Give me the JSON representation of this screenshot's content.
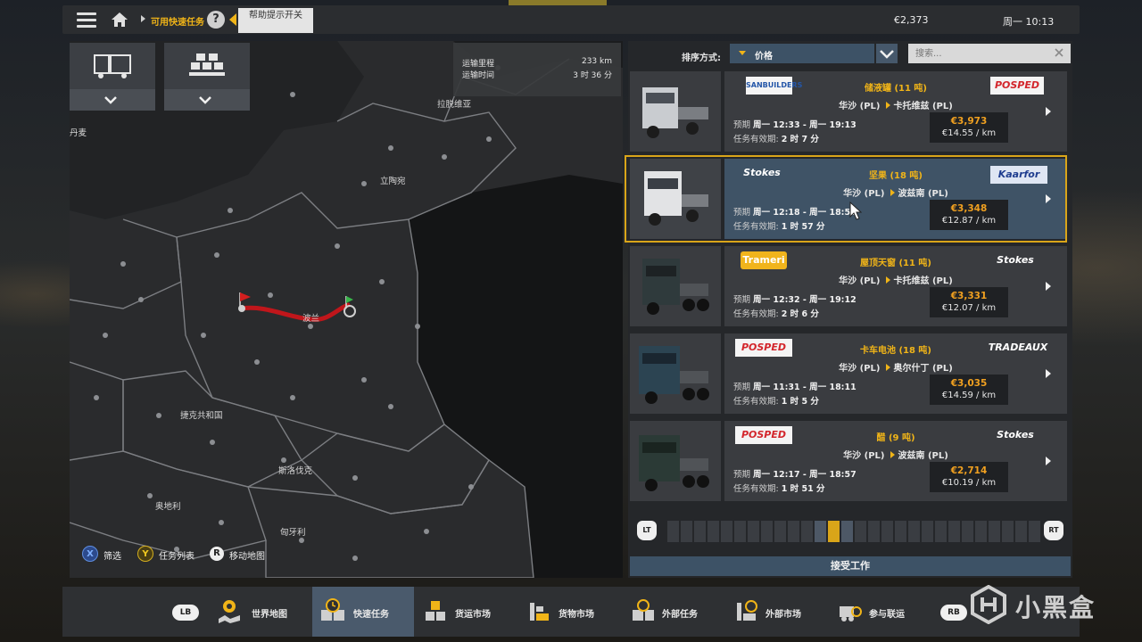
{
  "topbar": {
    "breadcrumb": "可用快速任务",
    "help_tooltip": "帮助提示开关",
    "money": "€2,373",
    "time": "周一 10:13"
  },
  "map": {
    "route_info": {
      "distance_label": "运输里程",
      "distance_value": "233 km",
      "time_label": "运输时间",
      "time_value": "3 时 36 分"
    },
    "countries": {
      "lithuania": "拉脱维亚",
      "lithuania2": "立陶宛",
      "poland": "波兰",
      "czech": "捷克共和国",
      "slovakia": "斯洛伐克",
      "austria": "奥地利",
      "hungary": "匈牙利",
      "denmark": "丹麦"
    },
    "legend": {
      "x_button": "X",
      "x_label": "筛选",
      "y_button": "Y",
      "y_label": "任务列表",
      "r_button": "R",
      "r_label": "移动地图"
    },
    "colors": {
      "route": "#c0161b",
      "selected_border": "#d9a519",
      "accent": "#f0b418"
    }
  },
  "list": {
    "sort_label": "排序方式:",
    "sort_value": "价格",
    "search_placeholder": "搜索...",
    "jobs": [
      {
        "source_company": "SANBUILDERS",
        "target_company": "POSPED",
        "cargo": "储液罐 (11 吨)",
        "from": "华沙 (PL)",
        "to": "卡托维兹 (PL)",
        "eta_label": "预期",
        "eta": "周一 12:33 - 周一 19:13",
        "valid_label": "任务有效期:",
        "valid": "2 时 7 分",
        "total": "€3,973",
        "per_km": "€14.55 / km"
      },
      {
        "source_company": "Stokes",
        "target_company": "Kaarfor",
        "cargo": "坚果 (18 吨)",
        "from": "华沙 (PL)",
        "to": "波兹南 (PL)",
        "eta_label": "预期",
        "eta": "周一 12:18 - 周一 18:58",
        "valid_label": "任务有效期:",
        "valid": "1 时 57 分",
        "total": "€3,348",
        "per_km": "€12.87 / km"
      },
      {
        "source_company": "Trameri",
        "target_company": "Stokes",
        "cargo": "屋顶天窗 (11 吨)",
        "from": "华沙 (PL)",
        "to": "卡托维兹 (PL)",
        "eta_label": "预期",
        "eta": "周一 12:32 - 周一 19:12",
        "valid_label": "任务有效期:",
        "valid": "2 时 6 分",
        "total": "€3,331",
        "per_km": "€12.07 / km"
      },
      {
        "source_company": "POSPED",
        "target_company": "TRADEAUX",
        "cargo": "卡车电池 (18 吨)",
        "from": "华沙 (PL)",
        "to": "奥尔什丁 (PL)",
        "eta_label": "预期",
        "eta": "周一 11:31 - 周一 18:11",
        "valid_label": "任务有效期:",
        "valid": "1 时 5 分",
        "total": "€3,035",
        "per_km": "€14.59 / km"
      },
      {
        "source_company": "POSPED",
        "target_company": "Stokes",
        "cargo": "醋 (9 吨)",
        "from": "华沙 (PL)",
        "to": "波兹南 (PL)",
        "eta_label": "预期",
        "eta": "周一 12:17 - 周一 18:57",
        "valid_label": "任务有效期:",
        "valid": "1 时 51 分",
        "total": "€2,714",
        "per_km": "€10.19 / km"
      }
    ],
    "pager": {
      "left": "LT",
      "right": "RT",
      "current_page": 12,
      "page_count": 28
    },
    "accept_label": "接受工作"
  },
  "bottombar": {
    "lb": "LB",
    "rb": "RB",
    "tabs": [
      "世界地图",
      "快速任务",
      "货运市场",
      "货物市场",
      "外部任务",
      "外部市场",
      "参与联运"
    ],
    "active_tab": "快速任务"
  },
  "watermark": "小黑盒"
}
